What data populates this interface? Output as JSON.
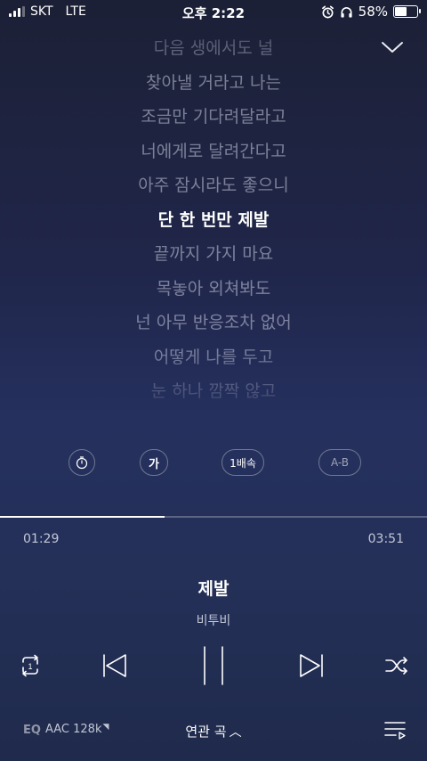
{
  "status_bar": {
    "carrier": "SKT",
    "network": "LTE",
    "time": "오후 2:22",
    "battery_text": "58%",
    "battery_level": 0.58,
    "signal_bars": 3
  },
  "lyrics": [
    "다음 생에서도 널",
    "찾아낼 거라고 나는",
    "조금만 기다려달라고",
    "너에게로 달려간다고",
    "아주 잠시라도 좋으니",
    "단 한 번만 제발",
    "끝까지 가지 마요",
    "목놓아 외쳐봐도",
    "넌 아무 반응조차 없어",
    "어떻게 나를 두고",
    "눈 하나 깜짝 않고"
  ],
  "current_lyric_index": 5,
  "options": {
    "font_label": "가",
    "speed_label": "1배속",
    "ab_label": "A-B"
  },
  "playback": {
    "current_time": "01:29",
    "total_time": "03:51",
    "progress": 0.385
  },
  "song": {
    "title": "제발",
    "artist": "비투비"
  },
  "controls": {
    "repeat_badge": "1"
  },
  "bottom_bar": {
    "eq_label": "EQ",
    "quality_label": "AAC 128k",
    "related_label": "연관 곡"
  },
  "icons": [
    "signal-icon",
    "alarm-icon",
    "headphones-icon",
    "battery-icon",
    "chevron-down-icon",
    "timer-icon",
    "repeat-one-icon",
    "previous-icon",
    "pause-icon",
    "next-icon",
    "shuffle-icon",
    "playlist-icon"
  ]
}
